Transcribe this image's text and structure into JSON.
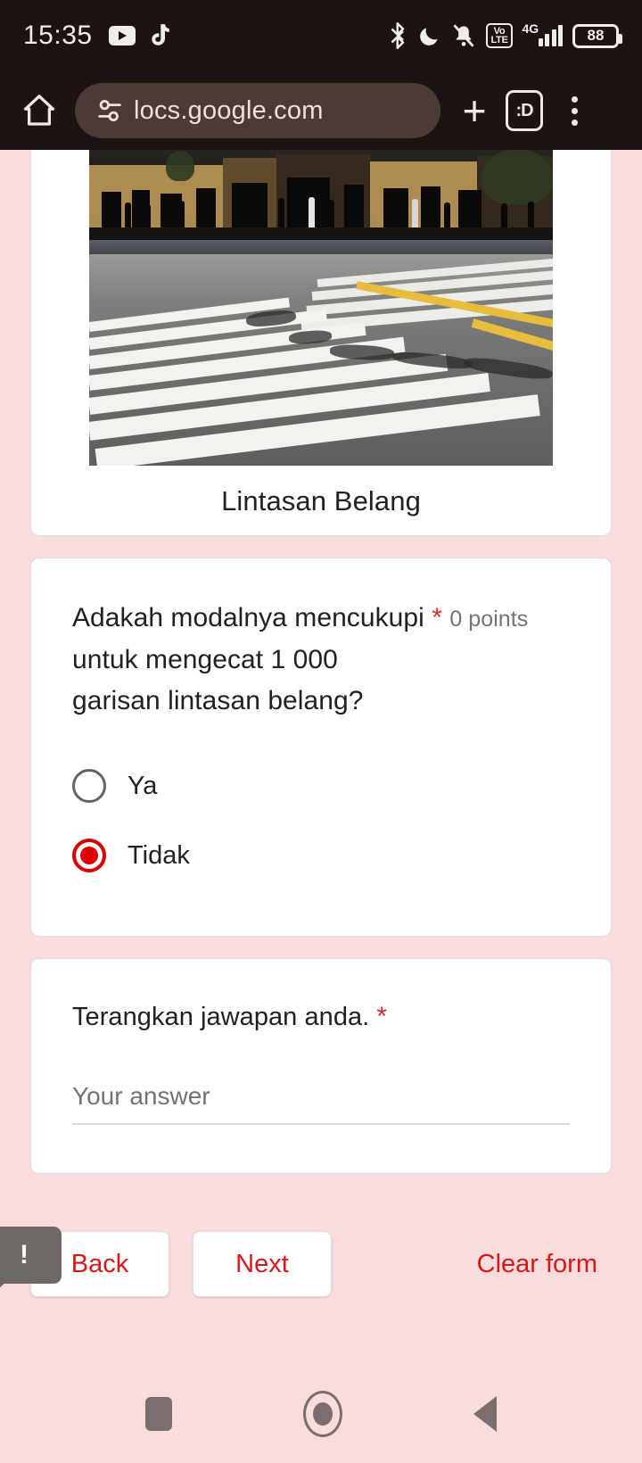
{
  "statusbar": {
    "time": "15:35",
    "battery_percent": "88",
    "icons": [
      "youtube-icon",
      "tiktok-icon",
      "bluetooth-icon",
      "do-not-disturb-icon",
      "vibrate-off-icon",
      "volte-icon",
      "signal-4g-icon",
      "battery-icon"
    ],
    "volte_top": "Vo",
    "volte_bottom": "LTE",
    "network_label": "4G"
  },
  "browser": {
    "url": "locs.google.com",
    "url_full_visible": "locs.google.com",
    "tab_count_label": ":D",
    "home_icon": "home-icon",
    "site_settings_icon": "tune-icon",
    "new_tab_icon": "plus-icon",
    "menu_icon": "three-dots-icon"
  },
  "form": {
    "image_card": {
      "caption": "Lintasan Belang",
      "alt": "zebra-crossing-photo"
    },
    "question_1": {
      "title_line_1": "Adakah modalnya mencukupi",
      "title_line_2": "untuk mengecat 1 000",
      "title_line_3": "garisan lintasan belang?",
      "required_marker": "*",
      "points": "0 points",
      "options": [
        {
          "label": "Ya",
          "selected": false
        },
        {
          "label": "Tidak",
          "selected": true
        }
      ]
    },
    "question_2": {
      "title": "Terangkan jawapan anda.",
      "required_marker": "*",
      "answer_value": "",
      "answer_placeholder": "Your answer"
    },
    "buttons": {
      "back": "Back",
      "next": "Next",
      "clear": "Clear form",
      "tooltip_badge": "!"
    }
  },
  "navbar": {
    "recents": "recents-square-icon",
    "home": "home-circle-icon",
    "back": "back-triangle-icon"
  },
  "colors": {
    "page_bg": "#fadcdc",
    "chrome_bg": "#1c1411",
    "accent_red": "#d81818",
    "radio_selected": "#e00000",
    "required_red": "#d93025",
    "card_bg": "#ffffff"
  }
}
